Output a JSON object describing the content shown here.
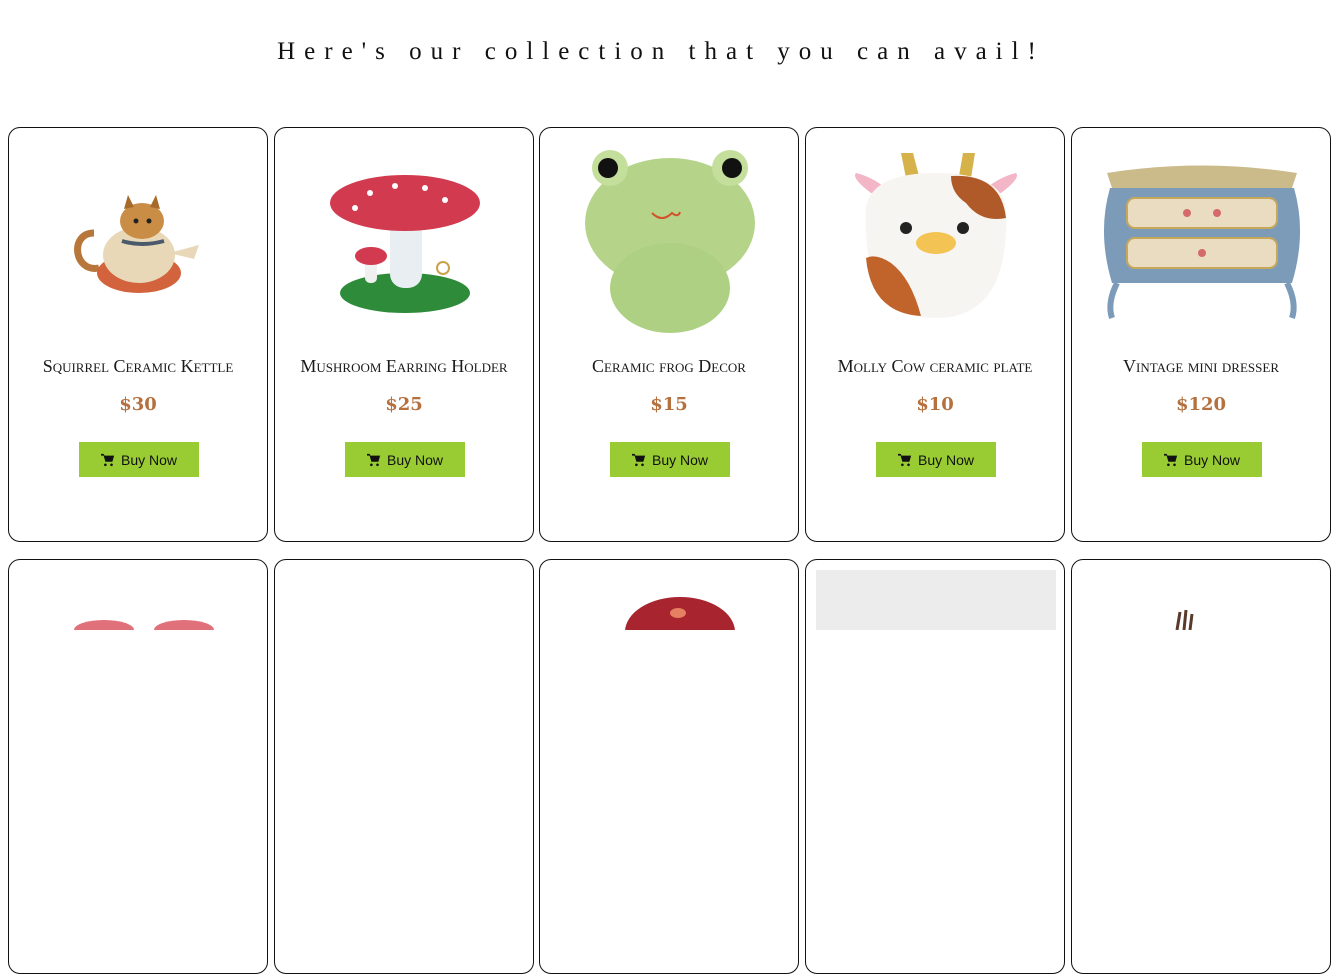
{
  "page": {
    "heading": "Here's our collection that you can avail!"
  },
  "products": [
    {
      "name": "Squirrel Ceramic Kettle",
      "price": "$30",
      "button": "Buy Now",
      "image": "squirrel-kettle-image"
    },
    {
      "name": "Mushroom Earring Holder",
      "price": "$25",
      "button": "Buy Now",
      "image": "mushroom-holder-image"
    },
    {
      "name": "Ceramic frog Decor",
      "price": "$15",
      "button": "Buy Now",
      "image": "frog-decor-image"
    },
    {
      "name": "Molly Cow ceramic plate",
      "price": "$10",
      "button": "Buy Now",
      "image": "cow-plate-image"
    },
    {
      "name": "Vintage mini dresser",
      "price": "$120",
      "button": "Buy Now",
      "image": "mini-dresser-image"
    }
  ],
  "colors": {
    "button_bg": "#99cc33",
    "price": "#b5703e",
    "border": "#111111"
  },
  "icons": {
    "cart": "shopping-cart-icon"
  }
}
